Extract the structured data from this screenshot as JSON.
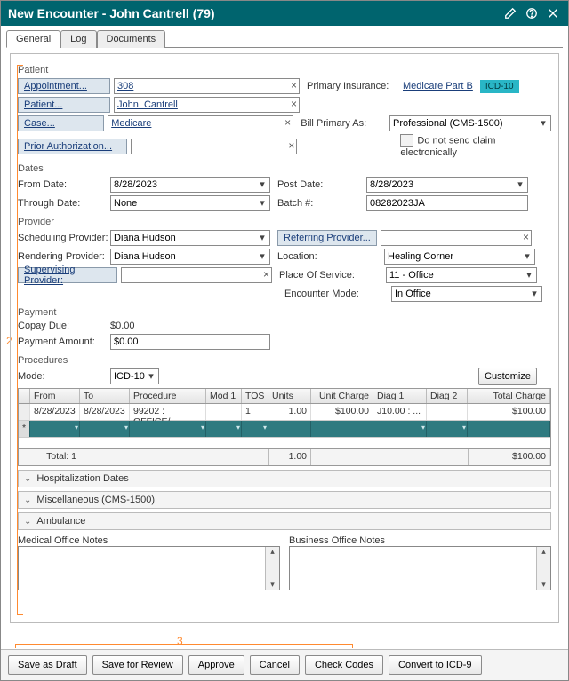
{
  "title": "New Encounter -  John  Cantrell  (79)",
  "tabs": [
    "General",
    "Log",
    "Documents"
  ],
  "active_tab": 0,
  "annotations": {
    "left": "2",
    "bottom": "3"
  },
  "patient": {
    "section": "Patient",
    "appointmentBtn": "Appointment...",
    "appointment": "308",
    "patientBtn": "Patient...",
    "patientName": "John  Cantrell",
    "caseBtn": "Case...",
    "caseValue": "Medicare",
    "priorAuthBtn": "Prior Authorization...",
    "priorAuthValue": "",
    "primaryInsLabel": "Primary Insurance:",
    "primaryInsValue": "Medicare Part B",
    "icdChip": "ICD-10",
    "billPrimaryLabel": "Bill Primary As:",
    "billPrimaryValue": "Professional (CMS-1500)",
    "noElecClaim": "Do not send claim electronically"
  },
  "dates": {
    "section": "Dates",
    "fromLabel": "From Date:",
    "from": "8/28/2023",
    "throughLabel": "Through Date:",
    "through": "None",
    "postLabel": "Post Date:",
    "post": "8/28/2023",
    "batchLabel": "Batch #:",
    "batch": "08282023JA"
  },
  "provider": {
    "section": "Provider",
    "schedLabel": "Scheduling Provider:",
    "sched": "Diana Hudson",
    "rendLabel": "Rendering Provider:",
    "rend": "Diana Hudson",
    "supBtn": "Supervising Provider:",
    "sup": "",
    "refBtn": "Referring Provider...",
    "ref": "",
    "locLabel": "Location:",
    "loc": "Healing Corner",
    "posLabel": "Place Of Service:",
    "pos": "11 - Office",
    "modeLabel": "Encounter Mode:",
    "mode": "In Office"
  },
  "payment": {
    "section": "Payment",
    "copayLabel": "Copay Due:",
    "copay": "$0.00",
    "amountLabel": "Payment Amount:",
    "amount": "$0.00"
  },
  "procedures": {
    "section": "Procedures",
    "modeLabel": "Mode:",
    "mode": "ICD-10",
    "customize": "Customize",
    "headers": [
      "From",
      "To",
      "Procedure",
      "Mod 1",
      "TOS",
      "Units",
      "Unit Charge",
      "Diag 1",
      "Diag 2",
      "Total Charge"
    ],
    "row": {
      "from": "8/28/2023",
      "to": "8/28/2023",
      "proc": "99202 : OFFICE/...",
      "mod1": "",
      "tos": "1",
      "units": "1.00",
      "unitCharge": "$100.00",
      "diag1": "J10.00 : ...",
      "diag2": "",
      "total": "$100.00"
    },
    "totalLabel": "Total:",
    "totalCount": "1",
    "totalUnits": "1.00",
    "totalCharge": "$100.00"
  },
  "collapsibles": [
    "Hospitalization Dates",
    "Miscellaneous (CMS-1500)",
    "Ambulance"
  ],
  "notes": {
    "medical": "Medical Office Notes",
    "business": "Business Office Notes"
  },
  "footer": [
    "Save as Draft",
    "Save for Review",
    "Approve",
    "Cancel",
    "Check Codes",
    "Convert to ICD-9"
  ]
}
